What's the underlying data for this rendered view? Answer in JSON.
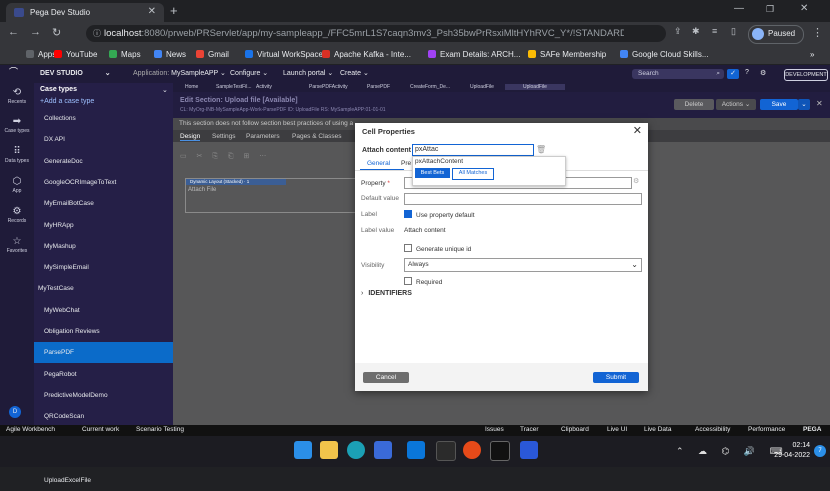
{
  "browser": {
    "tab_title": "Pega Dev Studio",
    "tab_close": "✕",
    "new_tab": "+",
    "url_host": "localhost",
    "url_rest": ":8080/prweb/PRServlet/app/my-sampleapp_/FFC5mrL1S7caqn3mv3_Psh35bwPrRsxiMltHYhRVC_Y*/!STANDARD?pzPostD...",
    "paused_label": "Paused",
    "bookmarks": [
      "Apps",
      "YouTube",
      "Maps",
      "News",
      "Gmail",
      "Virtual WorkSpace",
      "Apache Kafka - Inte...",
      "Exam Details: ARCH...",
      "SAFe Membership",
      "Google Cloud Skills..."
    ],
    "bookmark_colors": [
      "#5f6368",
      "#ff0000",
      "#34a853",
      "#4285f4",
      "#ea4335",
      "#1a73e8",
      "#d93025",
      "#a142f4",
      "#fbbc04",
      "#4285f4"
    ],
    "more_bookmarks": "»"
  },
  "pega_header": {
    "studio": "DEV STUDIO",
    "application_label": "Application:",
    "application_value": "MySampleAPP",
    "menus": [
      "Configure",
      "Launch portal",
      "Create"
    ],
    "search_placeholder": "Search",
    "badge": "DEVELOPMENT"
  },
  "left_nav": [
    "Recents",
    "Case types",
    "Data types",
    "App",
    "Records",
    "Favorites"
  ],
  "case_panel": {
    "title": "Case types",
    "add_label": "+Add a case type",
    "items": [
      "Collections",
      "DX API",
      "GenerateDoc",
      "GoogleOCRImageToText",
      "MyEmailBotCase",
      "MyHRApp",
      "MyMashup",
      "MySimpleEmail",
      "MyTestCase",
      "MyWebChat",
      "Obligation Reviews",
      "ParsePDF",
      "PegaRobot",
      "PredictiveModelDemo",
      "QRCodeScan",
      "SendSimpleEmail",
      "TestCase",
      "UploadExcelFile"
    ],
    "selected_index": 11,
    "user_initial": "D"
  },
  "work_tabs": [
    "Home",
    "SampleTestFil...",
    "Activity",
    "ParsePDFActivity",
    "ParsePDF",
    "CreateForm_De...",
    "UploadFile",
    "UploadFile"
  ],
  "editor": {
    "title": "Edit  Section: Upload file [Available]",
    "subtitle": "CL: MyOrg-INB-MySampleApp-Work-ParsePDF   ID: UploadFile   RS: MySampleAPP:01-01-01",
    "delete_label": "Delete",
    "actions_label": "Actions",
    "save_label": "Save",
    "notice": "This section does not follow section best practices of using a",
    "tabs": [
      "Design",
      "Settings",
      "Parameters",
      "Pages & Classes"
    ],
    "dynamic_layout": "Dynamic Layout (Stacked) · 1",
    "attach_label": "Attach File"
  },
  "modal": {
    "title": "Cell Properties",
    "close": "✕",
    "attach_content_label": "Attach content",
    "attach_content_value": "pxAttac",
    "autocomplete_item": "pxAttachContent",
    "tab_general": "General",
    "tab_presentation": "Pre",
    "best_bets": "Best Bets",
    "all_matches": "All Matches",
    "property_label": "Property",
    "default_value_label": "Default value",
    "label_label": "Label",
    "use_property_default": "Use property default",
    "label_value_label": "Label value",
    "label_value": "Attach content",
    "generate_unique_id": "Generate unique id",
    "visibility_label": "Visibility",
    "visibility_value": "Always",
    "required_label": "Required",
    "identifiers": "IDENTIFIERS",
    "cancel": "Cancel",
    "submit": "Submit"
  },
  "status_bar": [
    "Agile Workbench",
    "Current work",
    "Scenario Testing",
    "Issues",
    "Tracer",
    "Clipboard",
    "Live UI",
    "Live Data",
    "Accessibility",
    "Performance",
    "PEGA"
  ],
  "taskbar": {
    "time": "02:14",
    "date": "29-04-2022",
    "notif_count": "7"
  }
}
